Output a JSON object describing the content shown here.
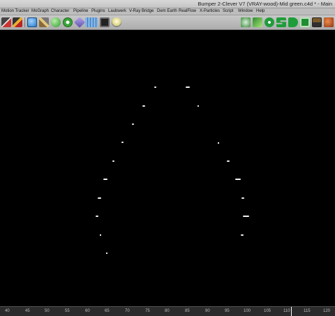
{
  "window": {
    "title": "Bumper 2-Clever V7 (VRAY-wood)-Mid green.c4d * - Main"
  },
  "menu": {
    "items": [
      "Motion Tracker",
      "MoGraph",
      "Character",
      "Pipeline",
      "Plugins",
      "Laubwerk",
      "V-Ray Bridge",
      "Dem Earth",
      "RealFlow",
      "X-Particles",
      "Script",
      "Window",
      "Help"
    ]
  },
  "toolbar": {
    "left_icons": [
      "render-view-icon",
      "render-settings-icon",
      "cube-icon",
      "pen-icon",
      "sphere-icon",
      "array-icon",
      "deformer-icon",
      "floor-icon",
      "camera-icon",
      "light-icon"
    ],
    "right_icons": [
      "plugin-cube-icon",
      "leaf-icon",
      "xp-icon",
      "s-icon",
      "d-icon",
      "sim-icon",
      "picture-icon",
      "tree-icon"
    ]
  },
  "timeline": {
    "labels": [
      "40",
      "45",
      "50",
      "55",
      "60",
      "65",
      "70",
      "75",
      "80",
      "85",
      "90",
      "95",
      "100",
      "105",
      "110",
      "115",
      "120"
    ],
    "current_frame": "110"
  }
}
